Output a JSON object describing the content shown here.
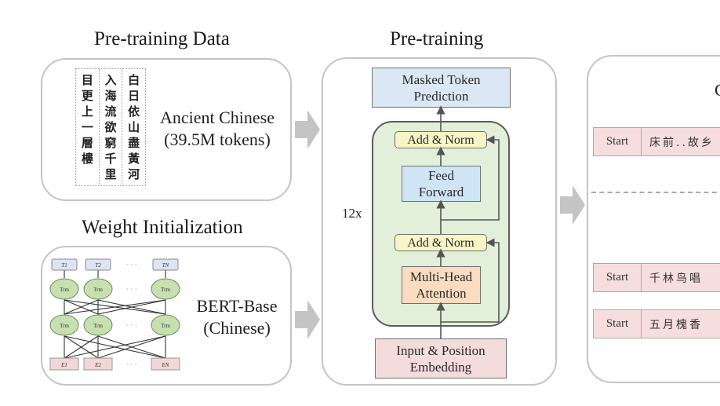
{
  "pretraining_data": {
    "title": "Pre-training Data",
    "label_line1": "Ancient Chinese",
    "label_line2": "(39.5M tokens)",
    "calligraphy_columns": [
      [
        "白",
        "日",
        "依",
        "山",
        "盡",
        "黃",
        "河"
      ],
      [
        "入",
        "海",
        "流",
        "欲",
        "窮",
        "千",
        "里"
      ],
      [
        "目",
        "更",
        "上",
        "一",
        "層",
        "樓"
      ]
    ]
  },
  "weight_init": {
    "title": "Weight Initialization",
    "label_line1": "BERT-Base",
    "label_line2": "(Chinese)",
    "outputs": [
      "T1",
      "T2",
      "TN"
    ],
    "layer_label": "Trm",
    "inputs": [
      "E1",
      "E2",
      "EN"
    ],
    "ellipsis": "· · ·"
  },
  "pretraining": {
    "title": "Pre-training",
    "head": "Masked Token Prediction",
    "head_line1": "Masked Token",
    "head_line2": "Prediction",
    "repeat": "12x",
    "add_norm": "Add & Norm",
    "ff_line1": "Feed",
    "ff_line2": "Forward",
    "mha_line1": "Multi-Head",
    "mha_line2": "Attention",
    "emb_line1": "Input & Position",
    "emb_line2": "Embedding"
  },
  "right_panel": {
    "title_partial": "C",
    "rows": [
      {
        "start": "Start",
        "text": "床前..故乡"
      },
      {
        "start": "Start",
        "text": "千林鸟唱"
      },
      {
        "start": "Start",
        "text": "五月槐香"
      }
    ]
  },
  "colors": {
    "arrow": "#c4c4c4",
    "panel_border": "#c4c4c4",
    "encoder_fill": "#e2efd9",
    "add_norm_fill": "#f7f5c6",
    "ff_fill": "#cfe5f6",
    "mha_fill": "#fbdcc0",
    "emb_fill": "#f5dcdc",
    "head_fill": "#dbe7f5"
  }
}
